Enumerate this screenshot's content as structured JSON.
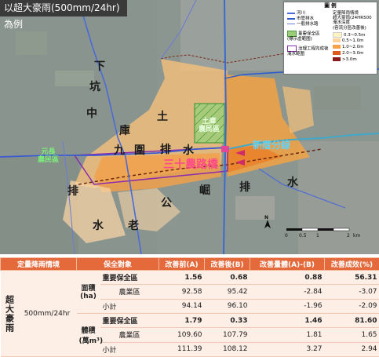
{
  "title": "以超大豪雨(500mm/24hr)為例",
  "map": {
    "labels": {
      "xia": "下",
      "keng": "坑",
      "zhong": "中",
      "ku": "庫",
      "tu": "土",
      "jiu": "九",
      "wei": "圍",
      "pai1": "排",
      "shui1": "水",
      "pai2": "排",
      "shui2": "水",
      "lao": "老",
      "gong": "公",
      "ju": "崛",
      "pai3": "排",
      "shui3": "水",
      "tuku_town": "土庫\n農民區",
      "yuanchang": "元長\n農民區",
      "sanshi_bridge": "三十農路橋",
      "xincuo": "新厝分線",
      "north": "N",
      "scale_0": "0",
      "scale_mid": "0.5",
      "scale_1": "1",
      "scale_2": "2",
      "scale_unit": "km"
    },
    "legend": {
      "title": "圖 例",
      "left_items": [
        {
          "label": "河川",
          "icon": "river-line"
        },
        {
          "label": "市管排水",
          "icon": "city-drain-line"
        },
        {
          "label": "一般排水路",
          "icon": "general-drain-line"
        },
        {
          "label": "重要保全區\n(標示虛範圍)",
          "icon": "protected-zone-box"
        },
        {
          "label": "治理工程完成後\n淹水範圍",
          "icon": "flood-range-box"
        }
      ],
      "right_title": "定量降雨情境\n超大豪雨(24HR500\n淹水深度\n(容流分區改善後)",
      "right_items": [
        {
          "label": "0.3~0.5m",
          "color": "#fff3c4"
        },
        {
          "label": "0.5~1.0m",
          "color": "#fdd39a"
        },
        {
          "label": "1.0~2.0m",
          "color": "#f5a24a"
        },
        {
          "label": "2.0~3.0m",
          "color": "#e05a1c"
        },
        {
          "label": ">3.0m",
          "color": "#8b1a1a"
        }
      ]
    }
  },
  "table": {
    "headers": [
      "定量降雨情境",
      "保全對象",
      "改善前(A)",
      "改善後(B)",
      "改善量體(A)-(B)",
      "改善成效(%)"
    ],
    "scenario": "超大豪雨",
    "rainfall": "500mm/24hr",
    "groups": [
      {
        "metric": "面積\n(ha)",
        "rows": [
          {
            "target": "重要保全區",
            "before": "1.56",
            "after": "0.68",
            "diff": "0.88",
            "eff": "56.31",
            "bold": true
          },
          {
            "target": "農業區",
            "before": "92.58",
            "after": "95.42",
            "diff": "-2.84",
            "eff": "-3.07",
            "bold": false
          },
          {
            "target": "小計",
            "before": "94.14",
            "after": "96.10",
            "diff": "-1.96",
            "eff": "-2.09",
            "bold": false
          }
        ]
      },
      {
        "metric": "體積\n(萬m³)",
        "rows": [
          {
            "target": "重要保全區",
            "before": "1.79",
            "after": "0.33",
            "diff": "1.46",
            "eff": "81.60",
            "bold": true
          },
          {
            "target": "農業區",
            "before": "109.60",
            "after": "107.79",
            "diff": "1.81",
            "eff": "1.65",
            "bold": false
          },
          {
            "target": "小計",
            "before": "111.39",
            "after": "108.12",
            "diff": "3.27",
            "eff": "2.94",
            "bold": false
          }
        ]
      }
    ]
  }
}
